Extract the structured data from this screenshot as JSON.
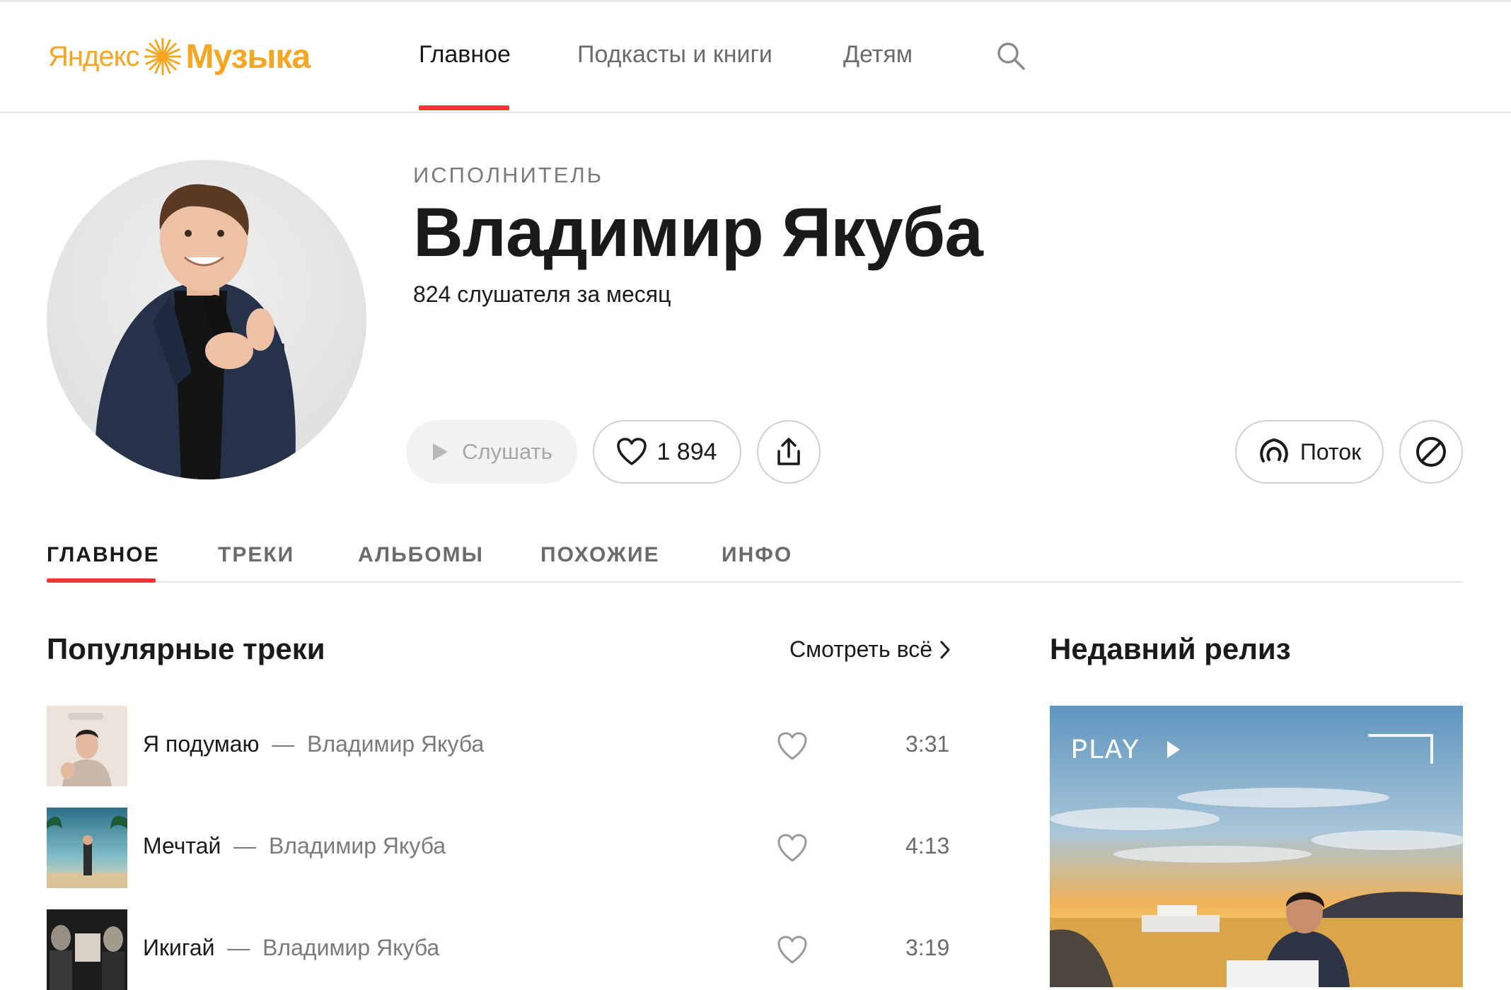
{
  "header": {
    "logo_left": "Яндекс",
    "logo_right": "Музыка",
    "nav": [
      {
        "label": "Главное",
        "active": true
      },
      {
        "label": "Подкасты и книги",
        "active": false
      },
      {
        "label": "Детям",
        "active": false
      }
    ],
    "search_icon": "search-icon"
  },
  "artist": {
    "type_label": "ИСПОЛНИТЕЛЬ",
    "name": "Владимир Якуба",
    "listeners": "824 слушателя за месяц",
    "avatar": "artist-photo"
  },
  "actions": {
    "listen": "Слушать",
    "likes": "1 894",
    "flow": "Поток"
  },
  "tabs": [
    {
      "label": "ГЛАВНОЕ",
      "active": true
    },
    {
      "label": "ТРЕКИ",
      "active": false
    },
    {
      "label": "АЛЬБОМЫ",
      "active": false
    },
    {
      "label": "ПОХОЖИЕ",
      "active": false
    },
    {
      "label": "ИНФО",
      "active": false
    }
  ],
  "popular": {
    "title": "Популярные треки",
    "see_all": "Смотреть всё",
    "tracks": [
      {
        "title": "Я подумаю",
        "artist": "Владимир Якуба",
        "duration": "3:31"
      },
      {
        "title": "Мечтай",
        "artist": "Владимир Якуба",
        "duration": "4:13"
      },
      {
        "title": "Икигай",
        "artist": "Владимир Якуба",
        "duration": "3:19"
      }
    ],
    "dash": "—"
  },
  "release": {
    "title": "Недавний релиз",
    "cover_text": "PLAY"
  },
  "colors": {
    "accent": "#ff3333",
    "logo": "#f5a623",
    "muted": "#7a7a7a"
  }
}
